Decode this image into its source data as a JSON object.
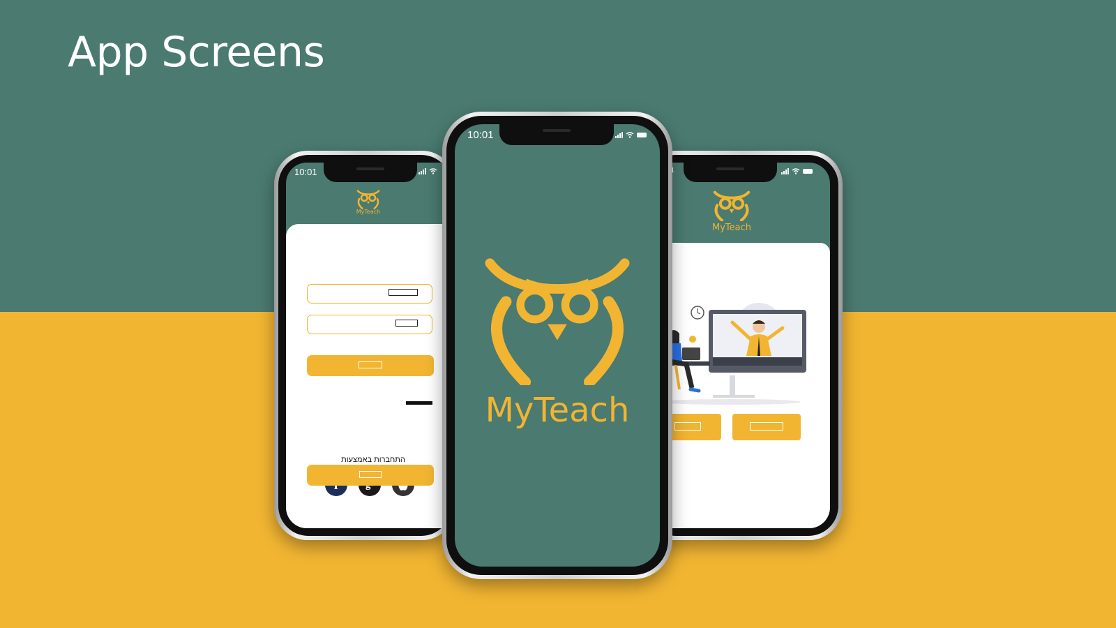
{
  "slide": {
    "title": "App Screens"
  },
  "colors": {
    "teal": "#4a7a70",
    "yellow": "#f2b532",
    "white": "#ffffff"
  },
  "brand": {
    "name": "MyTeach",
    "logo_icon": "owl-logo-icon"
  },
  "status_bar": {
    "time": "10:01"
  },
  "login_screen": {
    "social_label": "התחברות באמצעות",
    "social_icons": [
      "facebook-icon",
      "google-plus-icon",
      "apple-icon"
    ]
  },
  "onboarding_screen": {
    "illustration": "online-class-illustration"
  }
}
